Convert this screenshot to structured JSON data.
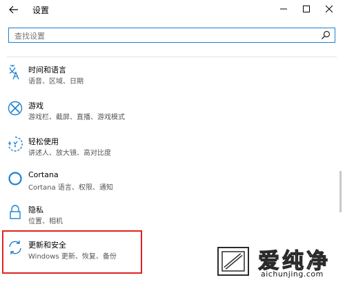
{
  "window": {
    "title": "设置",
    "back_icon": "back-arrow-icon",
    "minimize_icon": "minimize-icon",
    "maximize_icon": "maximize-icon",
    "close_icon": "close-icon"
  },
  "search": {
    "placeholder": "查找设置",
    "icon": "search-icon"
  },
  "items": [
    {
      "label": "时间和语言",
      "sub": "语音、区域、日期",
      "icon": "time-language-icon"
    },
    {
      "label": "游戏",
      "sub": "游戏栏、截屏、直播、游戏模式",
      "icon": "xbox-icon"
    },
    {
      "label": "轻松使用",
      "sub": "讲述人、放大镜、高对比度",
      "icon": "ease-of-access-icon"
    },
    {
      "label": "Cortana",
      "sub": "Cortana 语言、权限、通知",
      "icon": "cortana-icon"
    },
    {
      "label": "隐私",
      "sub": "位置、相机",
      "icon": "lock-icon"
    },
    {
      "label": "更新和安全",
      "sub": "Windows 更新、恢复、备份",
      "icon": "sync-icon"
    }
  ],
  "colors": {
    "accent": "#1a7fd4",
    "highlight": "#e02020"
  },
  "watermark": {
    "text": "爱纯净",
    "url": "aichunjing.com"
  }
}
